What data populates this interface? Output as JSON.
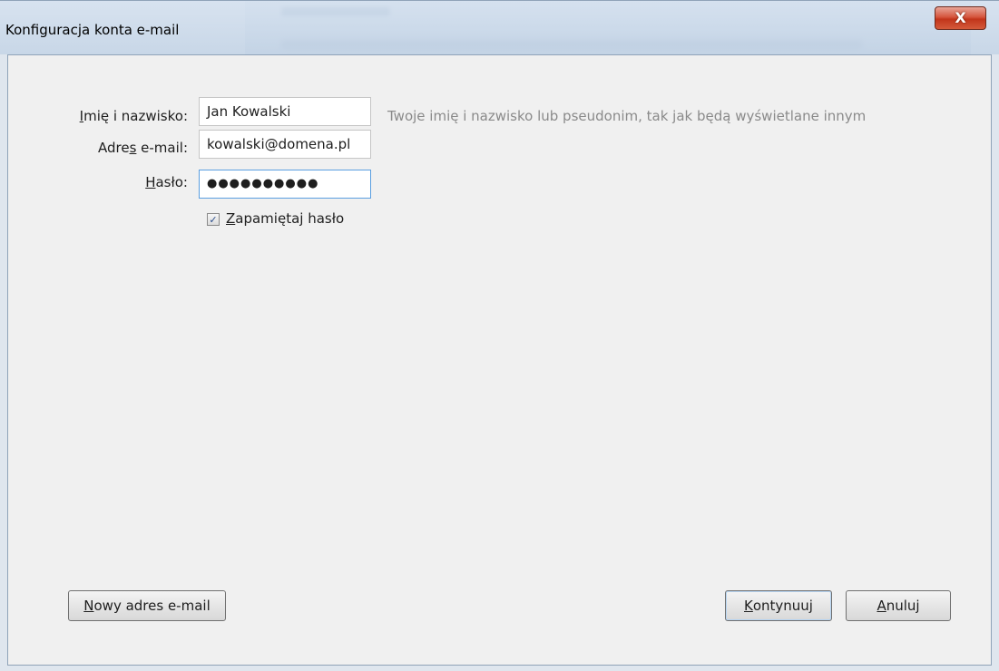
{
  "window": {
    "title": "Konfiguracja konta e-mail",
    "close_glyph": "X"
  },
  "form": {
    "name": {
      "label_accesskey": "I",
      "label_rest": "mię i nazwisko:",
      "value": "Jan Kowalski",
      "hint": "Twoje imię i nazwisko lub pseudonim, tak jak będą wyświetlane innym"
    },
    "email": {
      "label_start": "Adre",
      "label_accesskey": "s",
      "label_rest": " e-mail:",
      "value": "kowalski@domena.pl"
    },
    "password": {
      "label_accesskey": "H",
      "label_rest": "asło:",
      "value": "●●●●●●●●●●"
    },
    "remember": {
      "checked": true,
      "check_glyph": "✓",
      "label_accesskey": "Z",
      "label_rest": "apamiętaj hasło"
    }
  },
  "buttons": {
    "new_address": {
      "accesskey": "N",
      "rest": "owy adres e-mail"
    },
    "continue": {
      "accesskey": "K",
      "rest": "ontynuuj"
    },
    "cancel": {
      "accesskey": "A",
      "rest": "nuluj"
    }
  }
}
